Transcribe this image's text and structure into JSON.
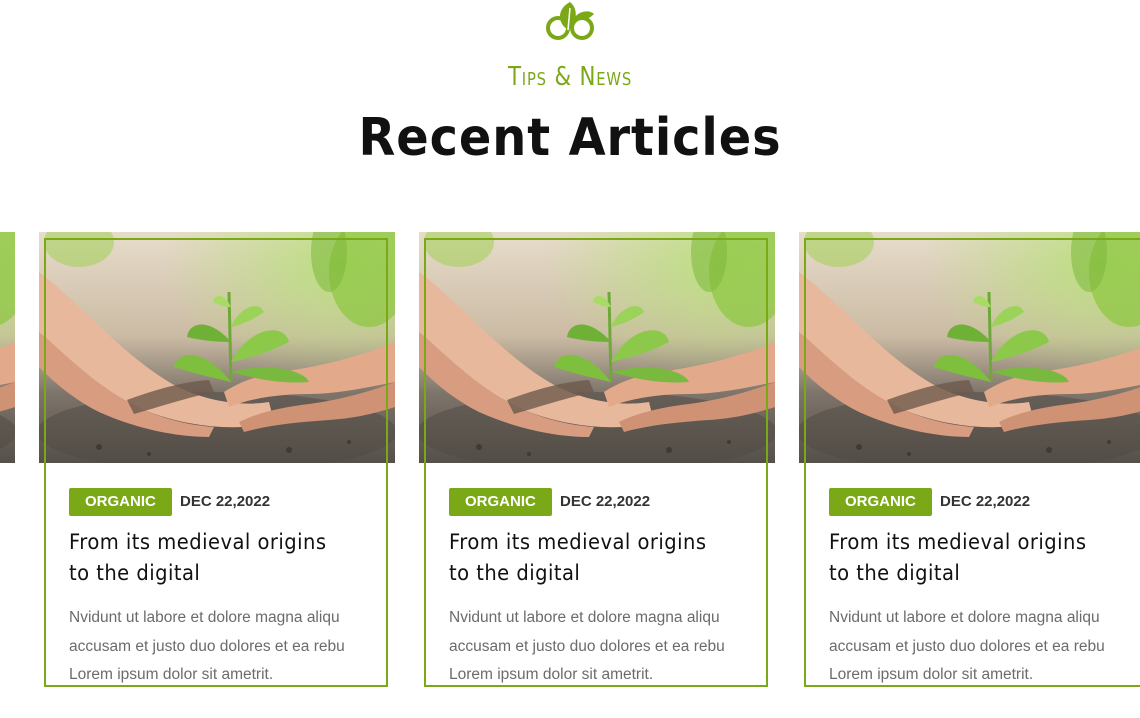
{
  "header": {
    "logo_icon": "leaf-logo-icon",
    "subtitle": "Tips & News",
    "title": "Recent Articles"
  },
  "colors": {
    "accent": "#7ba816",
    "title": "#111111",
    "body_text": "#6b6b6b"
  },
  "articles": [
    {
      "category": "ORGANIC",
      "date": "DEC 22,2022",
      "title": "From its medieval origins to the digital",
      "excerpt": "Nvidunt ut labore et dolore magna aliqu accusam et justo duo dolores et ea rebu Lorem ipsum dolor sit ametrit.",
      "image": "hands-planting-seedling-photo"
    },
    {
      "category": "ORGANIC",
      "date": "DEC 22,2022",
      "title": "From its medieval origins to the digital",
      "excerpt": "Nvidunt ut labore et dolore magna aliqu accusam et justo duo dolores et ea rebu Lorem ipsum dolor sit ametrit.",
      "image": "hands-planting-seedling-photo"
    },
    {
      "category": "ORGANIC",
      "date": "DEC 22,2022",
      "title": "From its medieval origins to the digital",
      "excerpt": "Nvidunt ut labore et dolore magna aliqu accusam et justo duo dolores et ea rebu Lorem ipsum dolor sit ametrit.",
      "image": "hands-planting-seedling-photo"
    }
  ]
}
